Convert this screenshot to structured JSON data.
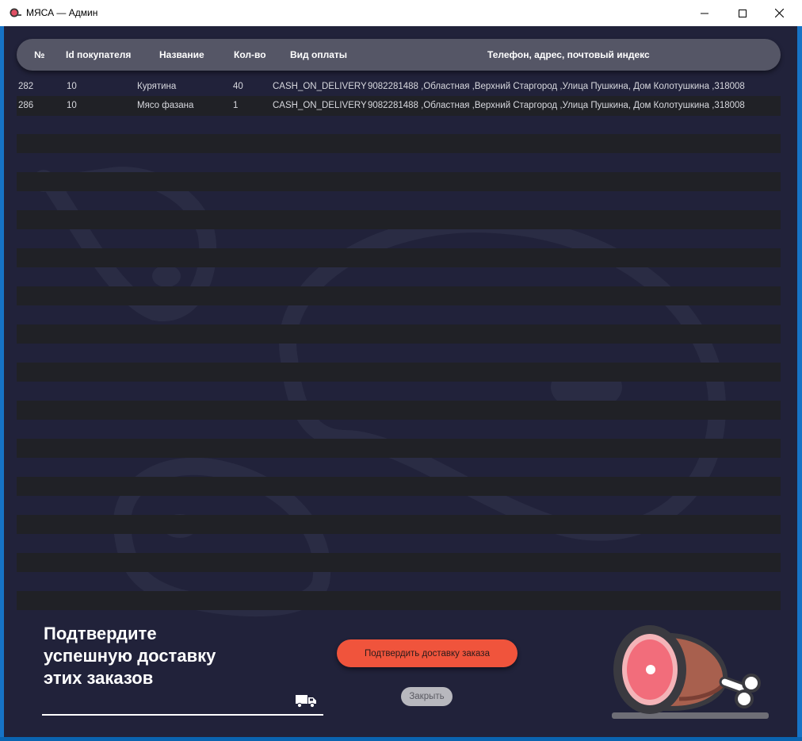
{
  "window": {
    "title": "МЯСА — Админ",
    "controls": {
      "minimize": "minimize-icon",
      "maximize": "maximize-icon",
      "close": "close-icon"
    }
  },
  "table": {
    "headers": [
      "№",
      "Id покупателя",
      "Название",
      "Кол-во",
      "Вид оплаты",
      "Телефон, адрес, почтовый индекс"
    ],
    "rows": [
      {
        "num": "282",
        "customer_id": "10",
        "name": "Курятина",
        "qty": "40",
        "payment": "CASH_ON_DELIVERY",
        "address": "9082281488 ,Областная ,Верхний Старгород ,Улица Пушкина, Дом Колотушкина ,318008"
      },
      {
        "num": "286",
        "customer_id": "10",
        "name": "Мясо фазана",
        "qty": "1",
        "payment": "CASH_ON_DELIVERY",
        "address": "9082281488 ,Областная ,Верхний Старгород ,Улица Пушкина, Дом Колотушкина ,318008"
      }
    ]
  },
  "footer": {
    "prompt_line1": "Подтвердите",
    "prompt_line2": "успешную доставку",
    "prompt_line3": "этих заказов",
    "confirm_button": "Подтвердить доставку заказа",
    "close_button": "Закрыть",
    "truck_icon": "truck-icon",
    "meat_icon": "meat-leg-icon"
  },
  "colors": {
    "background": "#21223a",
    "header": "#555666",
    "accent": "#f0543c",
    "stripe": "#202126"
  }
}
